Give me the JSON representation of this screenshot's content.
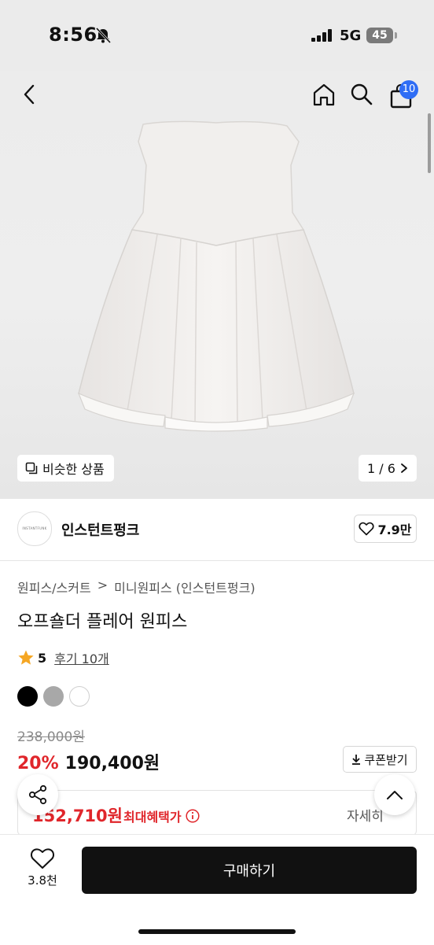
{
  "status": {
    "time": "8:56",
    "network": "5G",
    "battery": "45"
  },
  "header": {
    "cart_count": "10"
  },
  "gallery": {
    "similar_label": "비슷한 상품",
    "counter": "1 / 6"
  },
  "brand": {
    "logo_text": "INSTANTFUNK",
    "name": "인스턴트펑크",
    "likes": "7.9만"
  },
  "breadcrumb": {
    "level1": "원피스/스커트",
    "separator": ">",
    "level2": "미니원피스 (인스턴트펑크)"
  },
  "product": {
    "title": "오프숄더 플레어 원피스",
    "rating": "5",
    "reviews": "후기 10개",
    "colors": [
      "#000000",
      "#a8a8a8",
      "#ffffff"
    ],
    "original_price": "238,000원",
    "discount": "20%",
    "price": "190,400원",
    "coupon_label": "쿠폰받기",
    "benefit_price": "152,710원",
    "benefit_label": "최대혜택가",
    "detail_label": "자세히"
  },
  "bottom": {
    "like_count": "3.8천",
    "buy_label": "구매하기"
  }
}
